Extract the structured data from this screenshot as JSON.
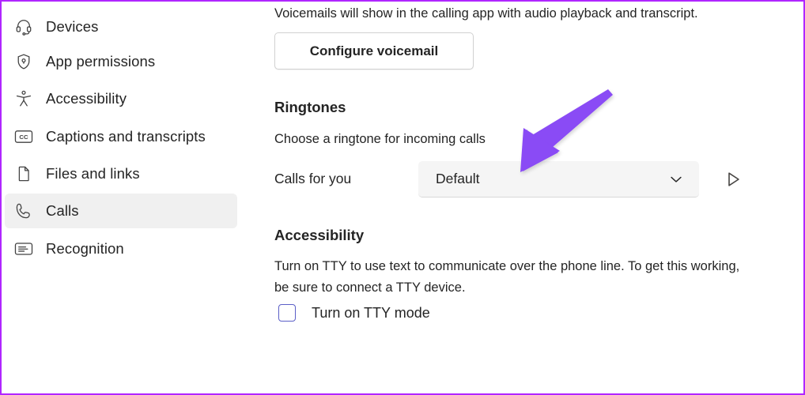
{
  "window": {
    "border_color": "#b026ff",
    "background": "#ffffff"
  },
  "sidebar": {
    "selected_background": "#f0f0f0",
    "items": [
      {
        "label": "Devices",
        "icon": "headset-icon",
        "selected": false
      },
      {
        "label": "App permissions",
        "icon": "shield-lock-icon",
        "selected": false
      },
      {
        "label": "Accessibility",
        "icon": "accessibility-icon",
        "selected": false
      },
      {
        "label": "Captions and transcripts",
        "icon": "closed-caption-icon",
        "selected": false
      },
      {
        "label": "Files and links",
        "icon": "document-icon",
        "selected": false
      },
      {
        "label": "Calls",
        "icon": "phone-icon",
        "selected": true
      },
      {
        "label": "Recognition",
        "icon": "recognition-icon",
        "selected": false
      }
    ]
  },
  "main": {
    "voicemail": {
      "description": "Voicemails will show in the calling app with audio playback and transcript.",
      "configure_button_label": "Configure voicemail"
    },
    "ringtones": {
      "heading": "Ringtones",
      "description": "Choose a ringtone for incoming calls",
      "field_label": "Calls for you",
      "selected_value": "Default",
      "options": [
        "Default"
      ],
      "chevron_icon": "chevron-down-icon",
      "play_icon": "play-triangle-icon"
    },
    "accessibility": {
      "heading": "Accessibility",
      "description": "Turn on TTY to use text to communicate over the phone line. To get this working, be sure to connect a TTY device.",
      "checkbox_label": "Turn on TTY mode",
      "checkbox_checked": false,
      "checkbox_accent": "#5b5fc7"
    }
  },
  "annotation": {
    "type": "arrow",
    "color": "#8a4bf5",
    "points_to": "ringtone-dropdown"
  }
}
